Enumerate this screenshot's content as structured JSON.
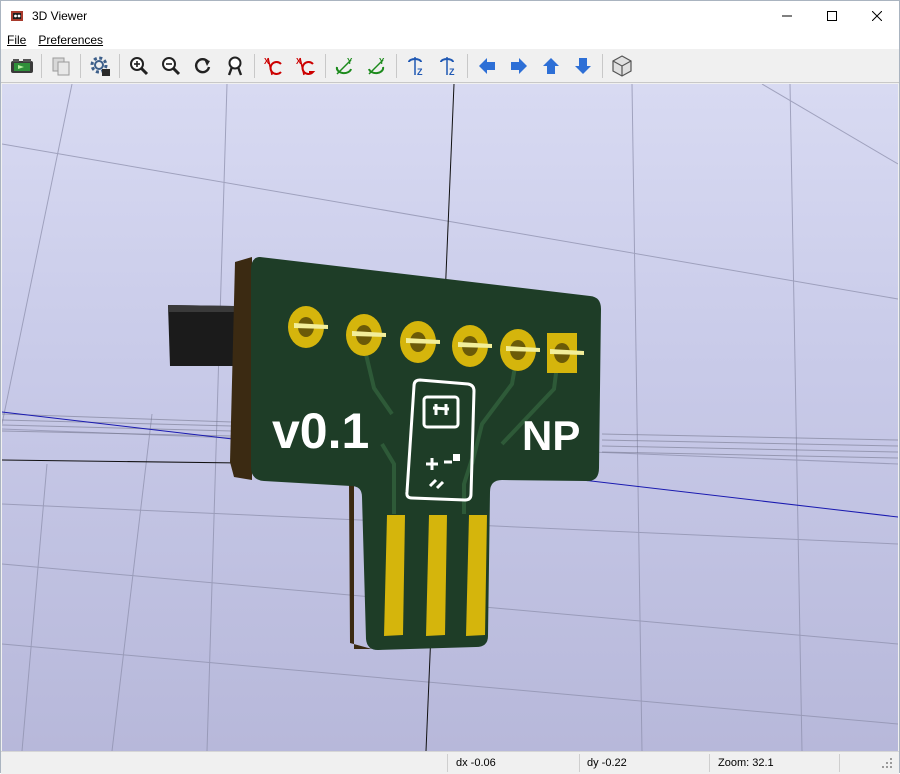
{
  "window": {
    "title": "3D Viewer",
    "icon": "3d-viewer-app-icon"
  },
  "menu": {
    "items": [
      "File",
      "Preferences"
    ]
  },
  "toolbar": {
    "buttons": [
      "render-raytraced-icon",
      "copy-image-icon",
      "settings-gear-icon",
      "zoom-in-icon",
      "zoom-out-icon",
      "redraw-icon",
      "zoom-fit-icon",
      "rotate-x-cw-icon",
      "rotate-x-ccw-icon",
      "rotate-y-cw-icon",
      "rotate-y-ccw-icon",
      "rotate-z-cw-icon",
      "rotate-z-ccw-icon",
      "pan-left-icon",
      "pan-right-icon",
      "pan-up-icon",
      "pan-down-icon",
      "ortho-perspective-icon"
    ]
  },
  "board": {
    "silkscreen_left": "v0.1",
    "silkscreen_right": "NP",
    "pad_count": 6,
    "edge_finger_count": 3
  },
  "colors": {
    "pcb": "#1e3d27",
    "copper_gold": "#d5b50c",
    "silkscreen": "#ffffff",
    "background_top": "#d8daf2",
    "background_bottom": "#b7b8da"
  },
  "status": {
    "dx": "dx -0.06",
    "dy": "dy -0.22",
    "zoom": "Zoom: 32.1"
  }
}
